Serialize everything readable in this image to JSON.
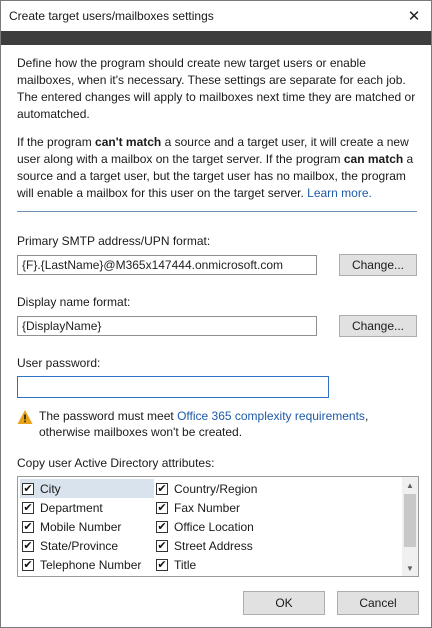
{
  "window": {
    "title": "Create target users/mailboxes settings",
    "close": "✕"
  },
  "intro": {
    "text": "Define how the program should create new target users or enable mailboxes, when it's necessary. These settings are separate for each job. The entered changes will apply to mailboxes next time they are matched or automatched."
  },
  "match_info": {
    "part1": "If the program ",
    "bold1": "can't match",
    "part2": " a source and a target user, it will create a new user along with a mailbox on the target server. If the program ",
    "bold2": "can match",
    "part3": " a source and a target user, but the target user has no mailbox, the program will enable a mailbox for this user on the target server. ",
    "link": "Learn more."
  },
  "smtp": {
    "label": "Primary SMTP address/UPN format:",
    "value": "{F}.{LastName}@M365x147444.onmicrosoft.com",
    "change_label": "Change..."
  },
  "display_name": {
    "label": "Display name format:",
    "value": "{DisplayName}",
    "change_label": "Change..."
  },
  "password": {
    "label": "User password:",
    "value": ""
  },
  "warning": {
    "part1": "The password must meet ",
    "link": "Office 365 complexity requirements",
    "part2": ", otherwise mailboxes won't be created."
  },
  "attributes": {
    "label": "Copy user Active Directory attributes:",
    "items": [
      {
        "label": "City",
        "checked": true
      },
      {
        "label": "Country/Region",
        "checked": true
      },
      {
        "label": "Department",
        "checked": true
      },
      {
        "label": "Fax Number",
        "checked": true
      },
      {
        "label": "Mobile Number",
        "checked": true
      },
      {
        "label": "Office Location",
        "checked": true
      },
      {
        "label": "State/Province",
        "checked": true
      },
      {
        "label": "Street Address",
        "checked": true
      },
      {
        "label": "Telephone Number",
        "checked": true
      },
      {
        "label": "Title",
        "checked": true
      }
    ]
  },
  "footer": {
    "ok": "OK",
    "cancel": "Cancel"
  },
  "colors": {
    "link": "#1e5aa8",
    "dark_band": "#3d3d3d",
    "focus_border": "#2e72c4",
    "warning": "#e8a317"
  },
  "icons": {
    "close": "close-icon",
    "warning": "warning-icon",
    "check": "checkmark-icon"
  }
}
